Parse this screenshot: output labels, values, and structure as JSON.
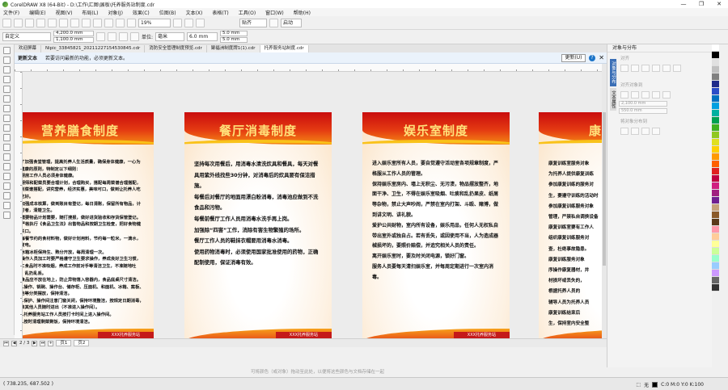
{
  "window": {
    "title": "CorelDRAW X8 (64-Bit) - D:\\工作\\汇图\\展板\\托养服务站制度.cdr"
  },
  "menu": [
    "文件(F)",
    "编辑(E)",
    "视图(V)",
    "布局(L)",
    "对象(J)",
    "效果(C)",
    "位图(B)",
    "文本(X)",
    "表格(T)",
    "工具(O)",
    "窗口(W)",
    "帮助(H)"
  ],
  "toolbar": {
    "zoom": "19%",
    "snap": "贴齐",
    "launch": "启动"
  },
  "propbar": {
    "preset": "自定义",
    "width": "4,200.0 mm",
    "height": "1,100.0 mm",
    "units_label": "单位:",
    "units": "毫米",
    "nudge": "6.0 mm",
    "dup_x": "5.0 mm",
    "dup_y": "5.0 mm"
  },
  "tabs": [
    "欢迎屏幕",
    "Nipic_33845821_20211227154530845.cdr",
    "消防安全管理制度预览.cdr",
    "聚福洲制度牌1(1).cdr",
    "托养服务站制度.cdr"
  ],
  "notice": {
    "title": "更新文本",
    "text": "若要访问最新的功能，必须更新文本。",
    "button": "更新(U)"
  },
  "posters": [
    {
      "title": "营养膳食制度",
      "body": "为了加强食堂管理，提高托养人生活质量，确保身体健康，一心为了健康的原则，特制定以下细则：\n1.厨房工作人员必须身体健康。\n2.厨师和配菜员要合理计划，合理购买，搭配每周菜谱合理搭配，做到菜谱搭配，讲究营养，经济实惠，美味可口，做到让托养人吃饱吃好。\n3.加强成本核算，做到账目有登记，每日清账，保留所有物品，计划付者，清楚卫生。\n4.需要物品计划需要，随打搜报，做好进货验收和存货保管登记。\n5.严格执行《食品卫生法》出售物品和按期卫生检查，把好食物健康关口。\n6.每餐节约的食材料物，做好计划用料，节约每一粒米，一滴水，一度电。\n7.冰箱冰柜保持生、熟分开放，每周清理一次。\n8.操作人员加工时要严格遵守卫生要求操作，养成良好卫生习惯，加工食品时不准吸烟，养成工作前对手等清洁卫生，不准随地吐痰，乱扔乱丢。\n9.食品应不放在地上，防止异物落入容器内，食品底桌尺寸清洁。\n10.操作、锅碗、操作台、储存柜、压面机、和面机、冰箱、案板、水池等分类摆放，保持清洁。\n11.保护、操作间注意门窗关闭，保持环境整洁，按规定日期消毒，不准其他人员随时进出（不准进入操作间）。\n12.托养服务站工作人员按打卡时间上进入操作间。\n13.按时清理剩菜剩饭，保持环境清洁。",
      "footer": "XXX托养服务站"
    },
    {
      "title": "餐厅消毒制度",
      "body": "坚持每次用餐后，用消毒水清洗炊具和餐具，每天对餐具用紫外线找些30分钟，对消毒后的炊具要有保洁措施。\n每餐后对餐厅的地面用漂白粉消毒，消毒池应做到不洗食品和污物。\n每餐前餐厅工作人员用消毒水洗手再上岗。\n加强除“四害”工作，消除有害生物繁殖的场所。\n餐厅工作人员的鞋抹衣帽要用消毒水消毒。\n使用药物消毒时，必须使用国家批准使用的药物，正确配制使用，保证消毒有效。",
      "footer": "XXX托养服务站"
    },
    {
      "title": "娱乐室制度",
      "body": "进入娱乐室所有人员，要自觉遵守活动室各项规章制度，严格服从工作人员的管理。\n保持娱乐室房内、墙上无积尘、无污渍，物品摆放整齐，地面干净、卫生，不得在娱乐室吸烟、吐痰和乱扔果皮、纸屑等杂物，禁止大声吵闹，严禁在室内打架、斗殴、赌博，做到讲文明、讲礼貌。\n爱护公共财物，室内所有设备，娱乐用品，任何人无权私自带出室外或独自占。若有丢失，或因使用不当，人为造成器械损坏的，要照价赔偿，并追究相关人员的责任。\n离开娱乐室时，要及时关闭电源，锁好门窗。\n服务人员要每天清扫娱乐室，并每周定期进行一次室内消毒。",
      "footer": "XXX托养服务站"
    },
    {
      "title": "康复训练制度",
      "body": "康复训练室服务对象\n为托养人提供康复训练\n参加康复训练的服务对\n生，要遵守训练的活动时\n参加康复训练服务对象\n管理，严禁私自调换设备\n康复训练室要有工作人\n组织康复训练服务对\n查，杜绝事故隐患。\n康复训练服务对象\n序操作康复器材，并\n材损坏或丢失的，\n根据托养人员的\n辅导人员为托养人员\n康复训练结束后\n生，保持室内安全整",
      "footer": ""
    }
  ],
  "pagebar": {
    "page": "2 / 3",
    "pages": [
      "页1",
      "页2"
    ]
  },
  "panel": {
    "title": "对象与分布",
    "section1": "对齐",
    "section2": "对齐对象到",
    "w": "2,100.0 mm",
    "h": "550.0 mm",
    "section3": "将对象分布到",
    "vtabs": [
      "对象与分布",
      "文本属性"
    ]
  },
  "hint": "可将颜色（或对象）拖动至此处，以便将这些颜色与文档存储在一起",
  "status": {
    "coords": "( 738.235, 687.502 )",
    "fill": "无",
    "outline": "C:0 M:0 Y:0 K:100"
  },
  "palette_colors": [
    "#ffffff",
    "#000000",
    "#e0e0e0",
    "#c0c0c0",
    "#808080",
    "#1f2a8a",
    "#2a4cc7",
    "#0070c0",
    "#00a0e0",
    "#00b0a0",
    "#00a050",
    "#40b020",
    "#90c820",
    "#e0e020",
    "#ffd000",
    "#ff9a00",
    "#ff6000",
    "#e02020",
    "#c00040",
    "#d02080",
    "#a02080",
    "#702090",
    "#c6a27a",
    "#8a5a2a",
    "#5a3a1a",
    "#ff99aa",
    "#ffcc99",
    "#ffff99",
    "#ccff99",
    "#99ffcc",
    "#99ccff",
    "#cc99ff",
    "#666666",
    "#333333"
  ]
}
